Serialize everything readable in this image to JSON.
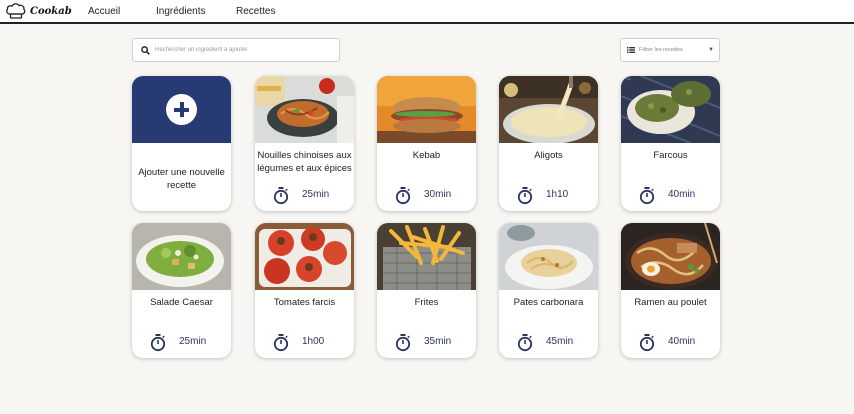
{
  "brand": {
    "name": "Cookab"
  },
  "nav": {
    "items": [
      "Accueil",
      "Ingrédients",
      "Recettes"
    ]
  },
  "search": {
    "placeholder": "Rechercher un ingrédient à ajouter",
    "icon": "search-icon"
  },
  "filter": {
    "placeholder": "Filtrer les recettes",
    "icon": "list-icon"
  },
  "add_card": {
    "label": "Ajouter une nouvelle recette",
    "color": "#283a73"
  },
  "recipes": [
    {
      "name": "Nouilles chinoises aux légumes et aux épices",
      "time": "25min"
    },
    {
      "name": "Kebab",
      "time": "30min"
    },
    {
      "name": "Aligots",
      "time": "1h10"
    },
    {
      "name": "Farcous",
      "time": "40min"
    },
    {
      "name": "Salade Caesar",
      "time": "25min"
    },
    {
      "name": "Tomates farcis",
      "time": "1h00"
    },
    {
      "name": "Frites",
      "time": "35min"
    },
    {
      "name": "Pates carbonara",
      "time": "45min"
    },
    {
      "name": "Ramen au poulet",
      "time": "40min"
    }
  ],
  "colors": {
    "accent": "#283a73",
    "timer": "#2b3463",
    "background": "#f7f6f3"
  }
}
